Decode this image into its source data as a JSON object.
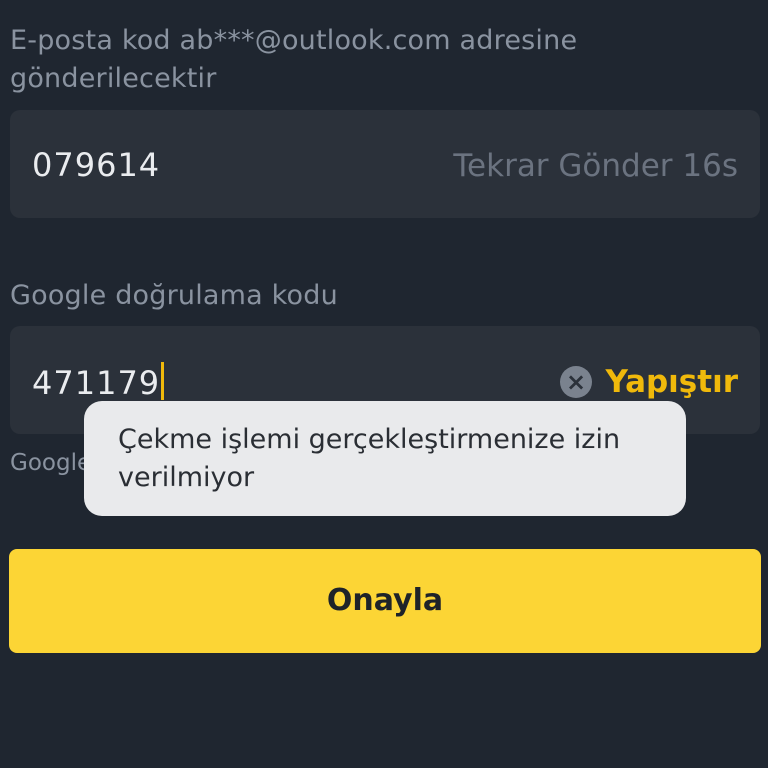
{
  "email_verification": {
    "label": "E-posta kod ab***@outlook.com adresine gönderilecektir",
    "value": "079614",
    "resend_label": "Tekrar Gönder 16s"
  },
  "google_verification": {
    "label": "Google doğrulama kodu",
    "value": "471179",
    "clear_icon": "×",
    "paste_label": "Yapıştır",
    "hint_partial": "Google"
  },
  "toast": {
    "message": "Çekme işlemi gerçekleştirmenize izin verilmiyor"
  },
  "confirm_button": {
    "label": "Onayla"
  },
  "colors": {
    "background": "#1f2630",
    "accent": "#f0b90b",
    "button": "#fcd535"
  }
}
